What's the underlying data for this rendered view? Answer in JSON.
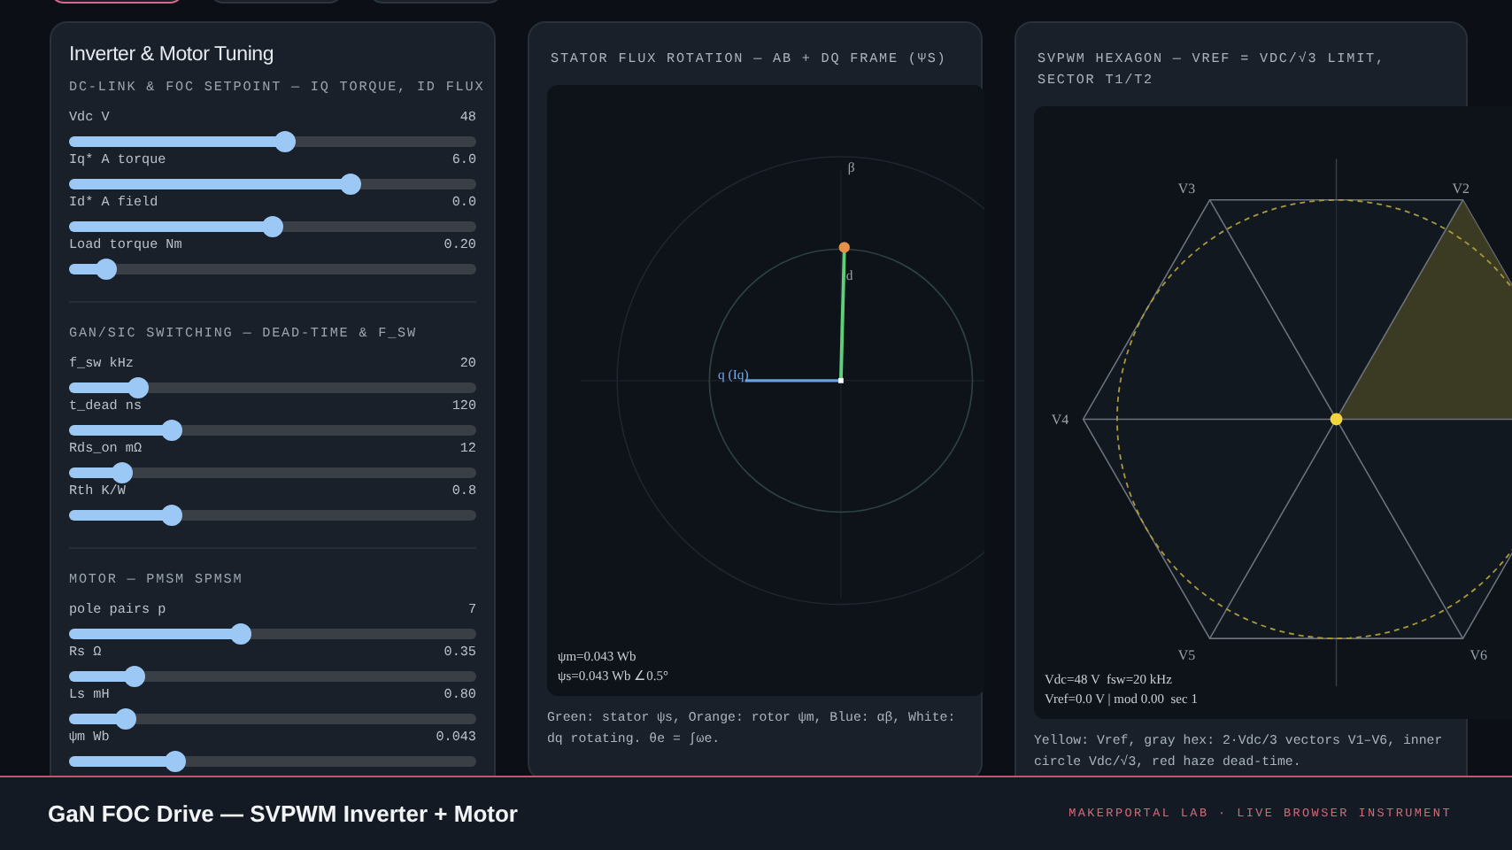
{
  "top_tabs": [
    {
      "selected": true
    },
    {
      "selected": false
    },
    {
      "selected": false
    }
  ],
  "tuning_panel": {
    "title": "Inverter & Motor Tuning",
    "sections": [
      {
        "heading": "DC-LINK & FOC SETPOINT — IQ TORQUE, ID FLUX",
        "sliders": [
          {
            "label": "Vdc V",
            "reading": "48",
            "level": 0.53
          },
          {
            "label": "Iq* A torque",
            "reading": "6.0",
            "level": 0.69
          },
          {
            "label": "Id* A field",
            "reading": "0.0",
            "level": 0.5
          },
          {
            "label": "Load torque Nm",
            "reading": "0.20",
            "level": 0.09
          }
        ]
      },
      {
        "heading": "GAN/SIC SWITCHING — DEAD-TIME & F_SW",
        "sliders": [
          {
            "label": "f_sw kHz",
            "reading": "20",
            "level": 0.17
          },
          {
            "label": "t_dead ns",
            "reading": "120",
            "level": 0.25
          },
          {
            "label": "Rds_on mΩ",
            "reading": "12",
            "level": 0.13
          },
          {
            "label": "Rth K/W",
            "reading": "0.8",
            "level": 0.25
          }
        ]
      },
      {
        "heading": "MOTOR — PMSM SPMSM",
        "sliders": [
          {
            "label": "pole pairs p",
            "reading": "7",
            "level": 0.42
          },
          {
            "label": "Rs Ω",
            "reading": "0.35",
            "level": 0.16
          },
          {
            "label": "Ls mH",
            "reading": "0.80",
            "level": 0.14
          },
          {
            "label": "ψm Wb",
            "reading": "0.043",
            "level": 0.26
          }
        ]
      }
    ]
  },
  "flux_panel": {
    "title": "STATOR FLUX ROTATION — AB + DQ FRAME (ΨS)",
    "axis_label": "β",
    "d_label": "d",
    "q_label": "q (Iq)",
    "readouts": [
      "ψm=0.043 Wb",
      "ψs=0.043 Wb ∠0.5°"
    ],
    "caption": "Green: stator ψs, Orange: rotor ψm, Blue: αβ, White: dq rotating. θe = ∫ωe."
  },
  "hex_panel": {
    "title": "SVPWM HEXAGON — VREF = VDC/√3 LIMIT, SECTOR T1/T2",
    "vectors": [
      "V2",
      "V3",
      "V4",
      "V5",
      "V6"
    ],
    "readouts": [
      "Vdc=48 V  fsw=20 kHz",
      "Vref=0.0 V | mod 0.00  sec 1"
    ],
    "caption": "Yellow: Vref, gray hex: 2·Vdc/3 vectors V1–V6, inner circle Vdc/√3, red haze dead-time."
  },
  "footer": {
    "title": "GaN FOC Drive — SVPWM Inverter + Motor",
    "credit": "MAKERPORTAL LAB · LIVE BROWSER INSTRUMENT"
  }
}
